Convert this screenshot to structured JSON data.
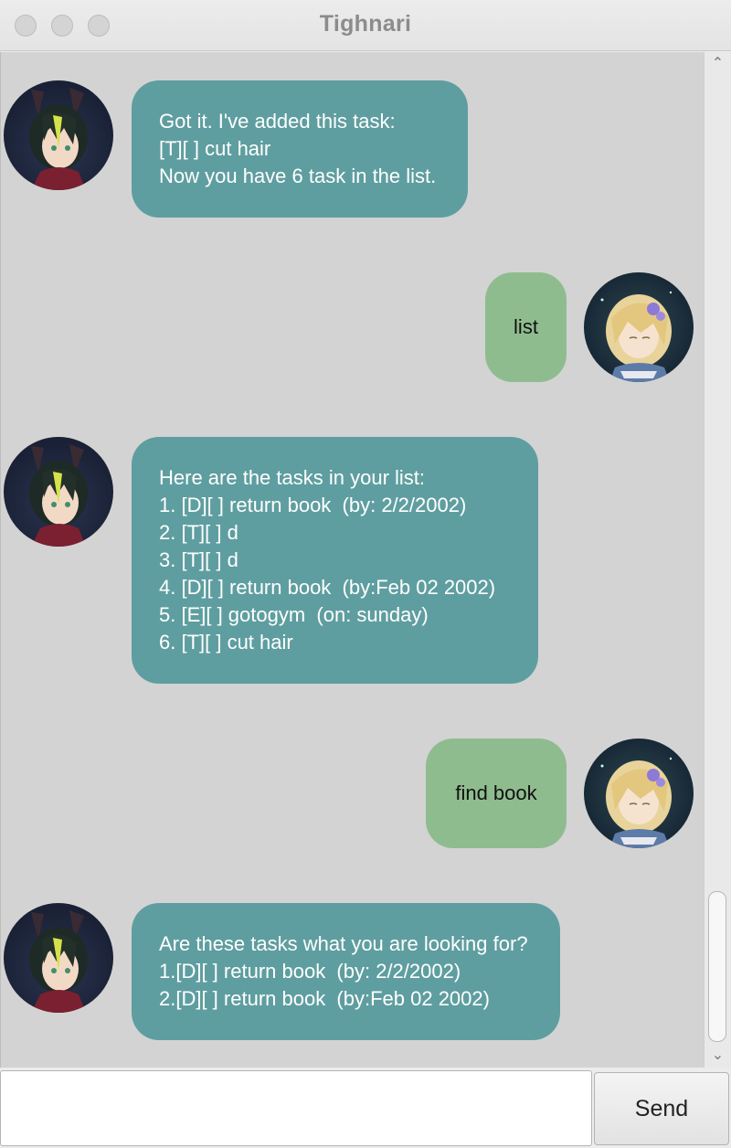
{
  "window": {
    "title": "Tighnari"
  },
  "messages": [
    {
      "role": "bot",
      "lines": [
        "Got it. I've added this task:",
        "[T][ ] cut hair",
        "Now you have 6 task in the list."
      ]
    },
    {
      "role": "user",
      "text": "list"
    },
    {
      "role": "bot",
      "lines": [
        "Here are the tasks in your list:",
        "1. [D][ ] return book  (by: 2/2/2002)",
        "2. [T][ ] d",
        "3. [T][ ] d",
        "4. [D][ ] return book  (by:Feb 02 2002)",
        "5. [E][ ] gotogym  (on: sunday)",
        "6. [T][ ] cut hair"
      ]
    },
    {
      "role": "user",
      "text": "find book"
    },
    {
      "role": "bot",
      "lines": [
        "Are these tasks what you are looking for?",
        "1.[D][ ] return book  (by: 2/2/2002)",
        "2.[D][ ] return book  (by:Feb 02 2002)"
      ]
    }
  ],
  "input": {
    "value": "",
    "placeholder": ""
  },
  "send_button": {
    "label": "Send"
  },
  "colors": {
    "bot_bubble": "#5f9ea0",
    "user_bubble": "#8fbc8f",
    "background": "#d3d3d3"
  },
  "icons": {
    "bot_avatar": "tighnari-avatar-icon",
    "user_avatar": "user-avatar-icon",
    "scroll_up": "chevron-up-icon",
    "scroll_down": "chevron-down-icon"
  }
}
